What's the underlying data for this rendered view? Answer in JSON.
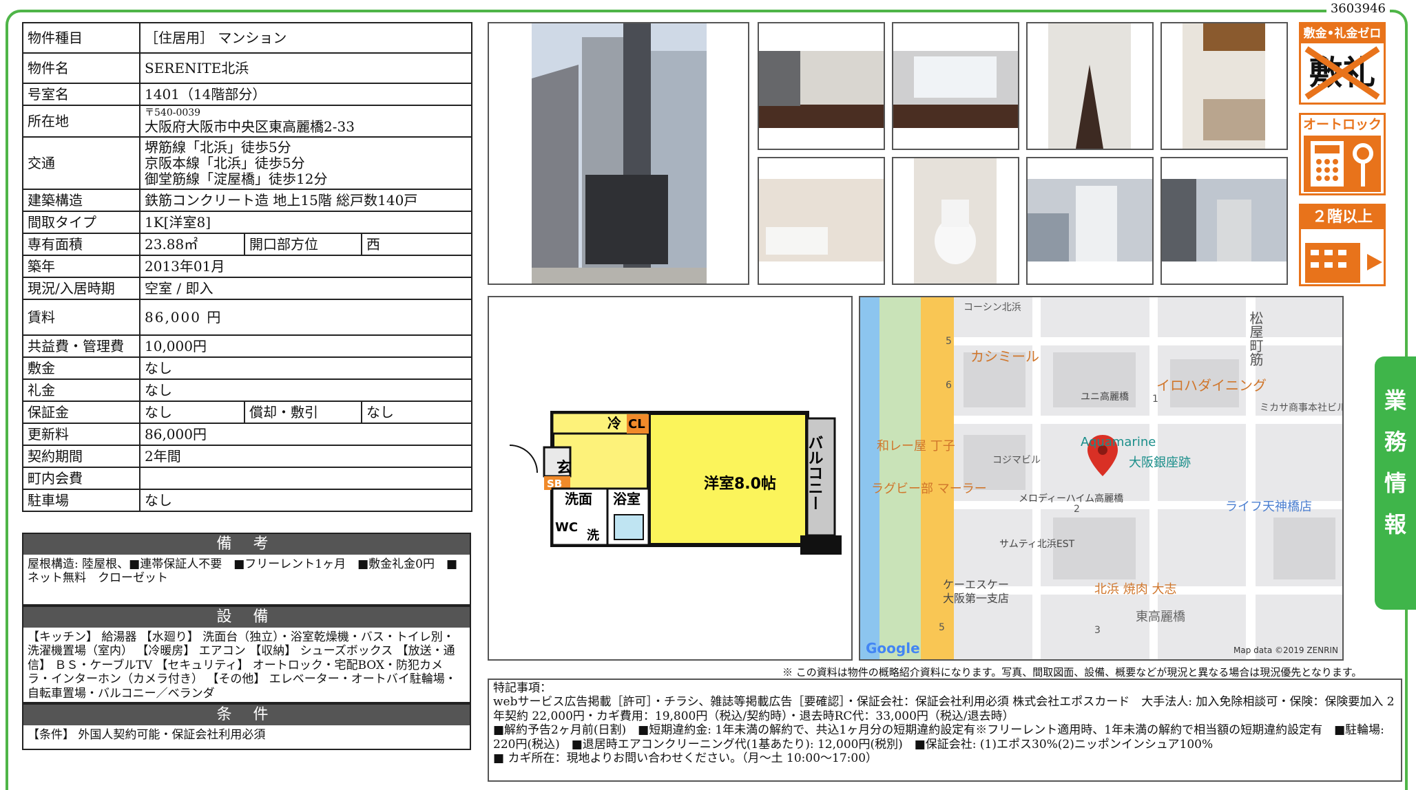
{
  "doc_id": "3603946",
  "table": {
    "type_label": "物件種目",
    "type_value": "［住居用］ マンション",
    "name_label": "物件名",
    "name_value": "SERENITE北浜",
    "room_label": "号室名",
    "room_value": "1401（14階部分）",
    "addr_label": "所在地",
    "addr_zip": "〒540-0039",
    "addr_value": "大阪府大阪市中央区東高麗橋2-33",
    "traffic_label": "交通",
    "traffic_1": "堺筋線「北浜」徒歩5分",
    "traffic_2": "京阪本線「北浜」徒歩5分",
    "traffic_3": "御堂筋線「淀屋橋」徒歩12分",
    "struct_label": "建築構造",
    "struct_value": "鉄筋コンクリート造 地上15階 総戸数140戸",
    "layout_label": "間取タイプ",
    "layout_value": "1K[洋室8]",
    "area_label": "専有面積",
    "area_value": "23.88㎡",
    "dir_label": "開口部方位",
    "dir_value": "西",
    "built_label": "築年",
    "built_value": "2013年01月",
    "status_label": "現況/入居時期",
    "status_value": "空室 / 即入",
    "rent_label": "賃料",
    "rent_value": "86,000 円",
    "fee_label": "共益費・管理費",
    "fee_value": "10,000円",
    "deposit_label": "敷金",
    "deposit_value": "なし",
    "keymoney_label": "礼金",
    "keymoney_value": "なし",
    "guarantee_label": "保証金",
    "guarantee_value": "なし",
    "amort_label": "償却・敷引",
    "amort_value": "なし",
    "renew_label": "更新料",
    "renew_value": "86,000円",
    "term_label": "契約期間",
    "term_value": "2年間",
    "town_label": "町内会費",
    "town_value": "",
    "parking_label": "駐車場",
    "parking_value": "なし"
  },
  "remarks": {
    "title": "備 考",
    "body": "屋根構造: 陸屋根、■連帯保証人不要　■フリーレント1ヶ月　■敷金礼金0円　■ネット無料　クローゼット"
  },
  "equipment": {
    "title": "設 備",
    "body": "【キッチン】 給湯器 【水廻り】 洗面台（独立）・浴室乾燥機・バス・トイレ別・洗濯機置場（室内） 【冷暖房】 エアコン 【収納】 シューズボックス 【放送・通信】 ＢＳ・ケーブルTV 【セキュリティ】 オートロック・宅配BOX・防犯カメラ・インターホン（カメラ付き） 【その他】 エレベーター・オートバイ駐輪場・自転車置場・バルコニー／ベランダ"
  },
  "conditions": {
    "title": "条 件",
    "body": "【条件】 外国人契約可能・保証会社利用必須"
  },
  "badges": {
    "b1_top": "敷金•礼金ゼロ",
    "b1_mark1": "敷",
    "b1_mark2": "礼",
    "b2_top": "オートロック",
    "b3_top": "２階以上"
  },
  "plan": {
    "genkan": "玄",
    "sb": "SB",
    "rei": "冷",
    "cl": "CL",
    "senmen": "洗面",
    "yokushitsu": "浴室",
    "wc": "WC",
    "sen": "洗",
    "youshitsu": "洋室8.0帖",
    "balcony": "バルコニー"
  },
  "map": {
    "labels": [
      "コーシン北浜",
      "カシミール",
      "松屋町筋",
      "イロハダイニング",
      "ユニ高麗橋",
      "ミカサ商事本社ビル",
      "和レー屋 丁子",
      "コジマビル",
      "Aquamarine",
      "大阪銀座跡",
      "ラグビー部 マーラー",
      "メロディーハイム高麗橋",
      "ライフ天神橋店",
      "サムティ北浜EST",
      "ケーエスケー",
      "大阪第一支店",
      "北浜 焼肉 大志",
      "東高麗橋"
    ],
    "numbers": [
      "5",
      "6",
      "1",
      "2",
      "3",
      "5"
    ],
    "google": "Google",
    "credit": "Map data ©2019 ZENRIN"
  },
  "sidetab": [
    "業",
    "務",
    "情",
    "報"
  ],
  "note": "※ この資料は物件の概略紹介資料になります。写真、間取図面、設備、概要などが現況と異なる場合は現況優先となります。",
  "tokki": {
    "l1": "特記事項：",
    "l2": "webサービス広告掲載［許可］・チラシ、雑誌等掲載広告［要確認］・保証会社：保証会社利用必須 株式会社エポスカード　大手法人: 加入免除相談可・保険：保険要加入 2年契約 22,000円・カギ費用：19,800円（税込/契約時）・退去時RC代：33,000円（税込/退去時）",
    "l3": "■解約予告2ヶ月前(日割)　■短期違約金: 1年未満の解約で、共込1ヶ月分の短期違約設定有※フリーレント適用時、1年未満の解約で相当額の短期違約設定有　■駐輪場: 220円(税込)　■退居時エアコンクリーニング代(1基あたり): 12,000円(税別)　■保証会社: (1)エポス30%(2)ニッポンインシュア100%",
    "l4": "■ カギ所在：現地よりお問い合わせください。（月～土 10:00～17:00）"
  }
}
